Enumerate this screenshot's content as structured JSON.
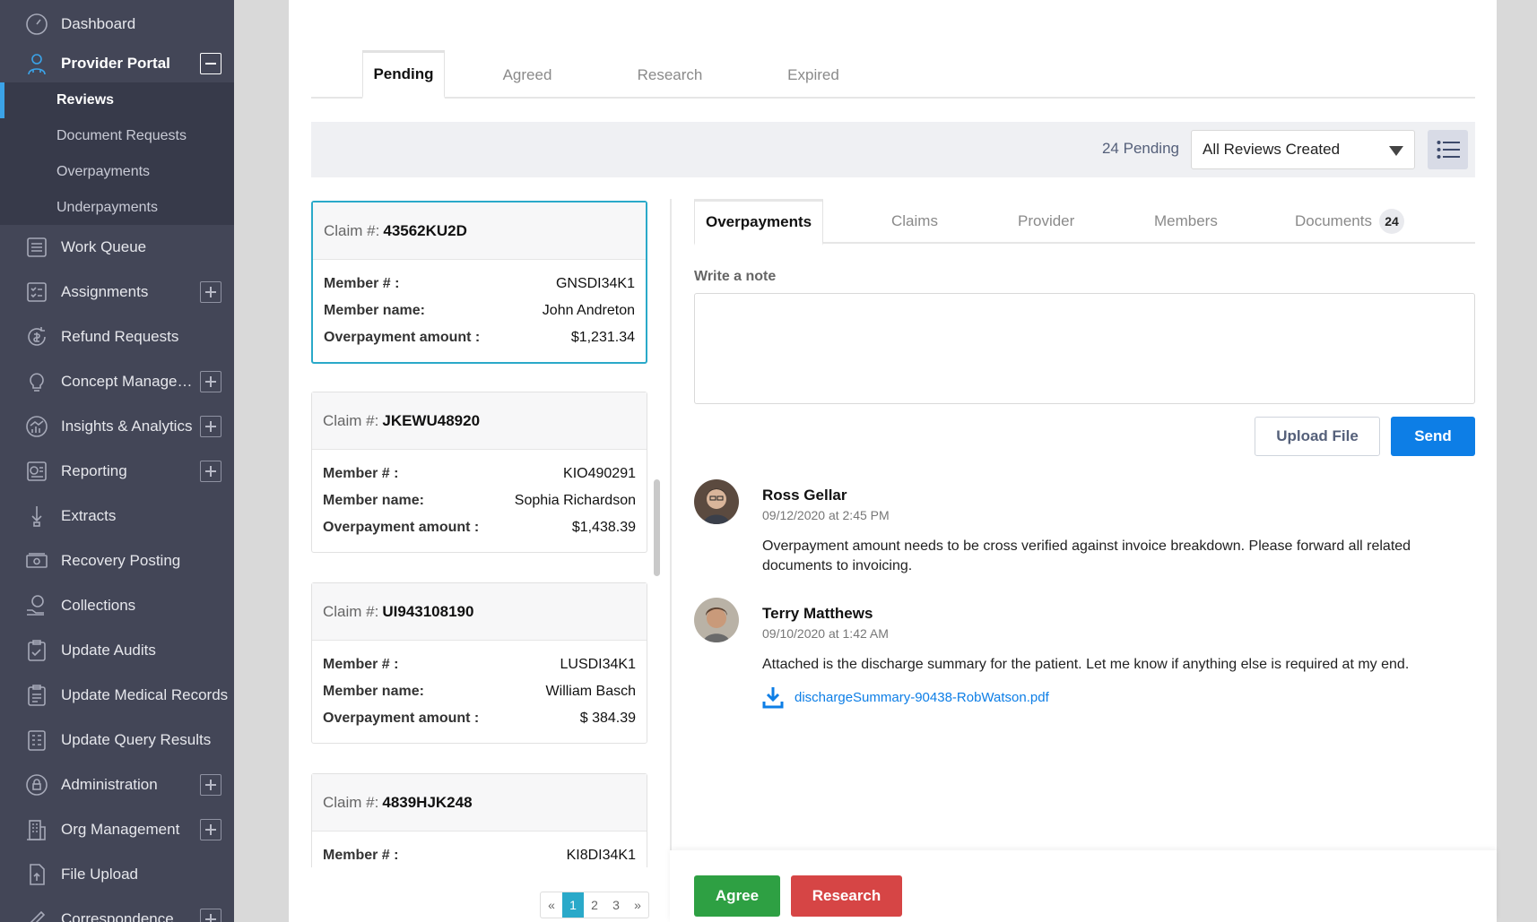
{
  "colors": {
    "sidebar_bg": "#434657",
    "accent": "#3ba3e8",
    "send": "#0d7ee6",
    "agree": "#2ea043",
    "research": "#d64545",
    "active_card": "#2aa9c9"
  },
  "sidebar": {
    "items": [
      {
        "label": "Dashboard",
        "icon": "dashboard-icon"
      },
      {
        "label": "Provider Portal",
        "icon": "provider-icon"
      },
      {
        "label": "Work Queue",
        "icon": "list-icon"
      },
      {
        "label": "Assignments",
        "icon": "checklist-icon"
      },
      {
        "label": "Refund Requests",
        "icon": "refund-icon"
      },
      {
        "label": "Concept Managem...",
        "icon": "lightbulb-icon"
      },
      {
        "label": "Insights & Analytics",
        "icon": "analytics-icon"
      },
      {
        "label": "Reporting",
        "icon": "report-icon"
      },
      {
        "label": "Extracts",
        "icon": "extract-icon"
      },
      {
        "label": "Recovery Posting",
        "icon": "money-icon"
      },
      {
        "label": "Collections",
        "icon": "collections-icon"
      },
      {
        "label": "Update Audits",
        "icon": "clipboard-check-icon"
      },
      {
        "label": "Update Medical Records",
        "icon": "clipboard-icon"
      },
      {
        "label": "Update Query Results",
        "icon": "query-icon"
      },
      {
        "label": "Administration",
        "icon": "lock-icon"
      },
      {
        "label": "Org Management",
        "icon": "building-icon"
      },
      {
        "label": "File Upload",
        "icon": "file-upload-icon"
      },
      {
        "label": "Correspondence",
        "icon": "pen-icon"
      }
    ],
    "sub_items": [
      "Reviews",
      "Document Requests",
      "Overpayments",
      "Underpayments"
    ]
  },
  "tabs_top": [
    "Pending",
    "Agreed",
    "Research",
    "Expired"
  ],
  "filter": {
    "pending_count": "24 Pending",
    "select_value": "All Reviews Created"
  },
  "claims": [
    {
      "claim_label": "Claim #:",
      "claim_no": "43562KU2D",
      "member_no": "GNSDI34K1",
      "member_name": "John Andreton",
      "amount": "$1,231.34"
    },
    {
      "claim_label": "Claim #:",
      "claim_no": "JKEWU48920",
      "member_no": "KIO490291",
      "member_name": "Sophia Richardson",
      "amount": "$1,438.39"
    },
    {
      "claim_label": "Claim #:",
      "claim_no": "UI943108190",
      "member_no": "LUSDI34K1",
      "member_name": "William Basch",
      "amount": "$ 384.39"
    },
    {
      "claim_label": "Claim #:",
      "claim_no": "4839HJK248",
      "member_no": "KI8DI34K1",
      "member_name": "",
      "amount": ""
    }
  ],
  "claim_keys": {
    "member_no": "Member # :",
    "member_name": "Member name:",
    "amount": "Overpayment amount :"
  },
  "pager": {
    "prev": "«",
    "pages": [
      "1",
      "2",
      "3"
    ],
    "next": "»",
    "current": "1"
  },
  "tabs_inner": [
    "Overpayments",
    "Claims",
    "Provider",
    "Members",
    "Documents"
  ],
  "documents_count": "24",
  "note": {
    "label": "Write a note",
    "upload": "Upload File",
    "send": "Send"
  },
  "comments": [
    {
      "name": "Ross Gellar",
      "time": "09/12/2020 at 2:45 PM",
      "text": "Overpayment amount needs to be cross verified against invoice breakdown. Please forward all related documents to invoicing."
    },
    {
      "name": "Terry Matthews",
      "time": "09/10/2020 at 1:42 AM",
      "text": "Attached is the discharge summary for the patient. Let me know if anything else is required at my end.",
      "attachment": "dischargeSummary-90438-RobWatson.pdf"
    }
  ],
  "actions": {
    "agree": "Agree",
    "research": "Research"
  }
}
